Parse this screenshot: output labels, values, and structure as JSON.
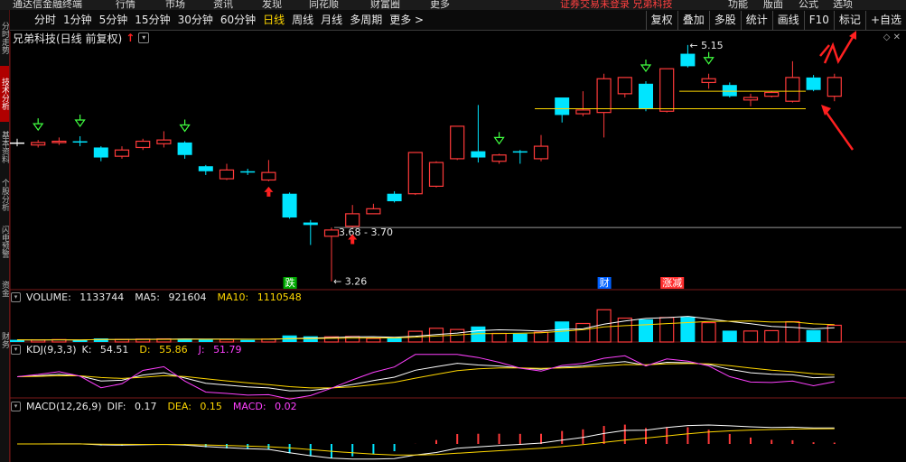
{
  "menubar": {
    "items": [
      "通达信金融终端",
      "行情",
      "市场",
      "资讯",
      "发现",
      "同花顺",
      "财富圈",
      "更多",
      "证券交易未登录  兄弟科技",
      "功能",
      "版面",
      "公式",
      "选项",
      "+自选"
    ]
  },
  "toolbar": {
    "periods": [
      "分时",
      "1分钟",
      "5分钟",
      "15分钟",
      "30分钟",
      "60分钟",
      "日线",
      "周线",
      "月线",
      "多周期",
      "更多 >"
    ],
    "active": "日线",
    "right": [
      "复权",
      "叠加",
      "多股",
      "统计",
      "画线",
      "F10",
      "标记"
    ],
    "right_extra": "+自选"
  },
  "sidebar": {
    "items": [
      "分时走势",
      "技术分析",
      "基本资料",
      "个股分析",
      "闪电预警",
      "资金",
      "财务"
    ],
    "active": "技术分析"
  },
  "title": {
    "text": "兄弟科技(日线 前复权)",
    "arrow": "↑"
  },
  "window_controls": "◇ ✕",
  "annotations": {
    "high": "5.15",
    "range": "3.68 - 3.70",
    "low": "3.26",
    "tags": [
      {
        "text": "跌",
        "bg": "#00aa00"
      },
      {
        "text": "财",
        "bg": "#0060ff"
      },
      {
        "text": "涨减",
        "bg": "#ff3030"
      }
    ]
  },
  "volume_legend": {
    "name": "VOLUME:",
    "value": "1133744",
    "ma5_label": "MA5:",
    "ma5": "921604",
    "ma10_label": "MA10:",
    "ma10": "1110548"
  },
  "kdj_legend": {
    "name": "KDJ(9,3,3)",
    "k_label": "K:",
    "k": "54.51",
    "d_label": "D:",
    "d": "55.86",
    "j_label": "J:",
    "j": "51.79"
  },
  "macd_legend": {
    "name": "MACD(12,26,9)",
    "dif_label": "DIF:",
    "dif": "0.17",
    "dea_label": "DEA:",
    "dea": "0.15",
    "macd_label": "MACD:",
    "macd": "0.02"
  },
  "colors": {
    "up": "#ff3a3a",
    "down": "#00e5ff",
    "flat": "#ffffff",
    "ma5": "#ffffff",
    "ma10": "#ffd700",
    "j": "#ff40ff"
  },
  "chart_data": {
    "type": "candlestick",
    "title": "兄弟科技(日线 前复权)",
    "candles": [
      {
        "o": 4.37,
        "c": 4.37,
        "h": 4.4,
        "l": 4.34,
        "vol": 0.18
      },
      {
        "o": 4.35,
        "c": 4.37,
        "h": 4.39,
        "l": 4.33,
        "vol": 0.16
      },
      {
        "o": 4.37,
        "c": 4.38,
        "h": 4.41,
        "l": 4.35,
        "vol": 0.2
      },
      {
        "o": 4.38,
        "c": 4.37,
        "h": 4.42,
        "l": 4.34,
        "vol": 0.17
      },
      {
        "o": 4.33,
        "c": 4.25,
        "h": 4.34,
        "l": 4.22,
        "vol": 0.3
      },
      {
        "o": 4.26,
        "c": 4.31,
        "h": 4.34,
        "l": 4.24,
        "vol": 0.22
      },
      {
        "o": 4.33,
        "c": 4.38,
        "h": 4.4,
        "l": 4.31,
        "vol": 0.24
      },
      {
        "o": 4.36,
        "c": 4.39,
        "h": 4.46,
        "l": 4.33,
        "vol": 0.26
      },
      {
        "o": 4.37,
        "c": 4.27,
        "h": 4.38,
        "l": 4.24,
        "vol": 0.28
      },
      {
        "o": 4.18,
        "c": 4.14,
        "h": 4.19,
        "l": 4.11,
        "vol": 0.25
      },
      {
        "o": 4.08,
        "c": 4.15,
        "h": 4.2,
        "l": 4.07,
        "vol": 0.21
      },
      {
        "o": 4.14,
        "c": 4.13,
        "h": 4.16,
        "l": 4.11,
        "vol": 0.17
      },
      {
        "o": 4.07,
        "c": 4.13,
        "h": 4.23,
        "l": 4.06,
        "vol": 0.24
      },
      {
        "o": 3.96,
        "c": 3.77,
        "h": 3.97,
        "l": 3.76,
        "vol": 0.55
      },
      {
        "o": 3.73,
        "c": 3.71,
        "h": 3.75,
        "l": 3.55,
        "vol": 0.48
      },
      {
        "o": 3.62,
        "c": 3.67,
        "h": 3.69,
        "l": 3.26,
        "vol": 0.43
      },
      {
        "o": 3.7,
        "c": 3.8,
        "h": 3.87,
        "l": 3.68,
        "vol": 0.46
      },
      {
        "o": 3.8,
        "c": 3.84,
        "h": 3.88,
        "l": 3.8,
        "vol": 0.3
      },
      {
        "o": 3.96,
        "c": 3.9,
        "h": 3.98,
        "l": 3.89,
        "vol": 0.34
      },
      {
        "o": 3.96,
        "c": 4.29,
        "h": 4.29,
        "l": 3.95,
        "vol": 0.9
      },
      {
        "o": 4.02,
        "c": 4.21,
        "h": 4.22,
        "l": 4.01,
        "vol": 1.15
      },
      {
        "o": 4.24,
        "c": 4.5,
        "h": 4.5,
        "l": 4.23,
        "vol": 1.05
      },
      {
        "o": 4.3,
        "c": 4.25,
        "h": 4.67,
        "l": 4.21,
        "vol": 1.3
      },
      {
        "o": 4.22,
        "c": 4.27,
        "h": 4.28,
        "l": 4.2,
        "vol": 0.72
      },
      {
        "o": 4.3,
        "c": 4.29,
        "h": 4.31,
        "l": 4.2,
        "vol": 0.7
      },
      {
        "o": 4.24,
        "c": 4.34,
        "h": 4.43,
        "l": 4.22,
        "vol": 0.82
      },
      {
        "o": 4.73,
        "c": 4.59,
        "h": 4.72,
        "l": 4.53,
        "vol": 1.72
      },
      {
        "o": 4.6,
        "c": 4.63,
        "h": 4.78,
        "l": 4.58,
        "vol": 1.55
      },
      {
        "o": 4.61,
        "c": 4.88,
        "h": 4.92,
        "l": 4.41,
        "vol": 2.7
      },
      {
        "o": 4.76,
        "c": 4.89,
        "h": 4.88,
        "l": 4.73,
        "vol": 2.0
      },
      {
        "o": 4.84,
        "c": 4.64,
        "h": 4.86,
        "l": 4.62,
        "vol": 1.9
      },
      {
        "o": 4.62,
        "c": 4.96,
        "h": 4.96,
        "l": 4.61,
        "vol": 2.05
      },
      {
        "o": 5.08,
        "c": 4.98,
        "h": 5.15,
        "l": 4.97,
        "vol": 2.1
      },
      {
        "o": 4.85,
        "c": 4.88,
        "h": 4.92,
        "l": 4.8,
        "vol": 1.62
      },
      {
        "o": 4.83,
        "c": 4.74,
        "h": 4.85,
        "l": 4.73,
        "vol": 0.95
      },
      {
        "o": 4.71,
        "c": 4.73,
        "h": 4.76,
        "l": 4.66,
        "vol": 0.92
      },
      {
        "o": 4.74,
        "c": 4.77,
        "h": 4.78,
        "l": 4.73,
        "vol": 0.95
      },
      {
        "o": 4.7,
        "c": 4.89,
        "h": 5.02,
        "l": 4.69,
        "vol": 1.7
      },
      {
        "o": 4.89,
        "c": 4.79,
        "h": 4.91,
        "l": 4.78,
        "vol": 1.0
      },
      {
        "o": 4.74,
        "c": 4.89,
        "h": 4.92,
        "l": 4.7,
        "vol": 1.4
      }
    ],
    "volume_series": [
      {
        "name": "MA5"
      },
      {
        "name": "MA10"
      }
    ],
    "kdj_series": [
      {
        "name": "K"
      },
      {
        "name": "D"
      },
      {
        "name": "J"
      }
    ],
    "macd_series": [
      {
        "name": "DIF"
      },
      {
        "name": "DEA"
      },
      {
        "name": "MACD"
      }
    ],
    "price_range": [
      3.2,
      5.25
    ],
    "grid": false
  }
}
